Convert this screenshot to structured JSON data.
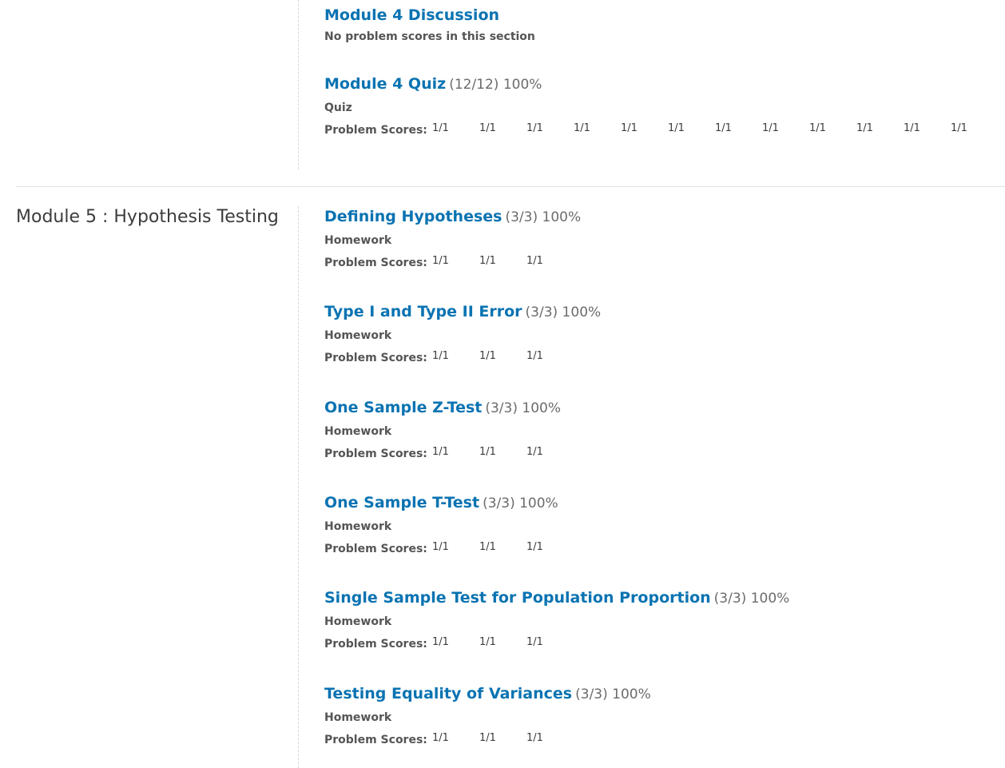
{
  "module4": {
    "sections": [
      {
        "title": "Module 4 Discussion",
        "score": "",
        "type": "",
        "no_scores": "No problem scores in this section",
        "scores": []
      },
      {
        "title": "Module 4 Quiz",
        "score": "(12/12) 100%",
        "type": "Quiz",
        "no_scores": "",
        "scores": [
          "1/1",
          "1/1",
          "1/1",
          "1/1",
          "1/1",
          "1/1",
          "1/1",
          "1/1",
          "1/1",
          "1/1",
          "1/1",
          "1/1"
        ]
      }
    ]
  },
  "module5": {
    "title": "Module 5 : Hypothesis Testing",
    "sections": [
      {
        "title": "Defining Hypotheses",
        "score": "(3/3) 100%",
        "type": "Homework",
        "scores": [
          "1/1",
          "1/1",
          "1/1"
        ]
      },
      {
        "title": "Type I and Type II Error",
        "score": "(3/3) 100%",
        "type": "Homework",
        "scores": [
          "1/1",
          "1/1",
          "1/1"
        ]
      },
      {
        "title": "One Sample Z-Test",
        "score": "(3/3) 100%",
        "type": "Homework",
        "scores": [
          "1/1",
          "1/1",
          "1/1"
        ]
      },
      {
        "title": "One Sample T-Test",
        "score": "(3/3) 100%",
        "type": "Homework",
        "scores": [
          "1/1",
          "1/1",
          "1/1"
        ]
      },
      {
        "title": "Single Sample Test for Population Proportion",
        "score": "(3/3) 100%",
        "type": "Homework",
        "scores": [
          "1/1",
          "1/1",
          "1/1"
        ]
      },
      {
        "title": "Testing Equality of Variances",
        "score": "(3/3) 100%",
        "type": "Homework",
        "scores": [
          "1/1",
          "1/1",
          "1/1"
        ]
      }
    ]
  },
  "labels": {
    "problem_scores": "Problem Scores:"
  },
  "colors": {
    "link": "#0a73b2",
    "text": "#3c3c3c",
    "divider": "#e0e0e0"
  }
}
